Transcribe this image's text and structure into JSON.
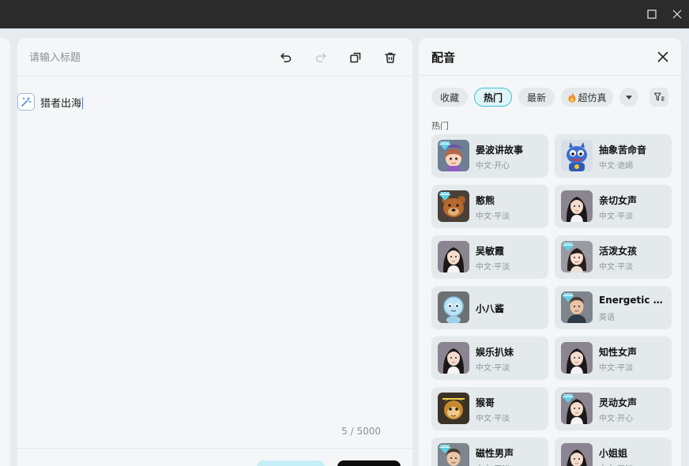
{
  "editor": {
    "title_placeholder": "请输入标题",
    "line_text": "猎者出海",
    "char_count": "5 / 5000"
  },
  "voice_panel": {
    "title": "配音",
    "filters": [
      {
        "label": "收藏",
        "active": false
      },
      {
        "label": "热门",
        "active": true
      },
      {
        "label": "最新",
        "active": false
      },
      {
        "label": "超仿真",
        "active": false,
        "icon": "fire-icon"
      }
    ],
    "section_label": "热门",
    "voices": [
      {
        "name": "晏波讲故事",
        "tag": "中文·开心",
        "avatar": "cartoon-girl-hat",
        "badge": true
      },
      {
        "name": "抽象苦命音",
        "tag": "中文·诡嫣",
        "avatar": "blue-monster",
        "badge": false
      },
      {
        "name": "憨熊",
        "tag": "中文·平淡",
        "avatar": "bear",
        "badge": true
      },
      {
        "name": "亲切女声",
        "tag": "中文·平淡",
        "avatar": "woman",
        "badge": false
      },
      {
        "name": "吴敏霞",
        "tag": "中文·平淡",
        "avatar": "woman",
        "badge": false
      },
      {
        "name": "活泼女孩",
        "tag": "中文·平淡",
        "avatar": "girl",
        "badge": true
      },
      {
        "name": "小八酱",
        "tag": "",
        "avatar": "blue-robot",
        "badge": false
      },
      {
        "name": "Energetic M...",
        "tag": "英语",
        "avatar": "man",
        "badge": true
      },
      {
        "name": "娱乐扒妹",
        "tag": "中文·平淡",
        "avatar": "woman",
        "badge": false
      },
      {
        "name": "知性女声",
        "tag": "中文·平淡",
        "avatar": "woman",
        "badge": false
      },
      {
        "name": "猴哥",
        "tag": "中文·平淡",
        "avatar": "monkey-king",
        "badge": false
      },
      {
        "name": "灵动女声",
        "tag": "中文·开心",
        "avatar": "woman",
        "badge": true
      },
      {
        "name": "磁性男声",
        "tag": "中文·平淡",
        "avatar": "man",
        "badge": true
      },
      {
        "name": "小姐姐",
        "tag": "中文·平淡",
        "avatar": "woman",
        "badge": false
      }
    ]
  },
  "colors": {
    "accent": "#3cc3d4",
    "titlebar": "#2b2b2b",
    "panel_bg": "#f4f6f8",
    "card_bg": "#e4e9ec"
  }
}
